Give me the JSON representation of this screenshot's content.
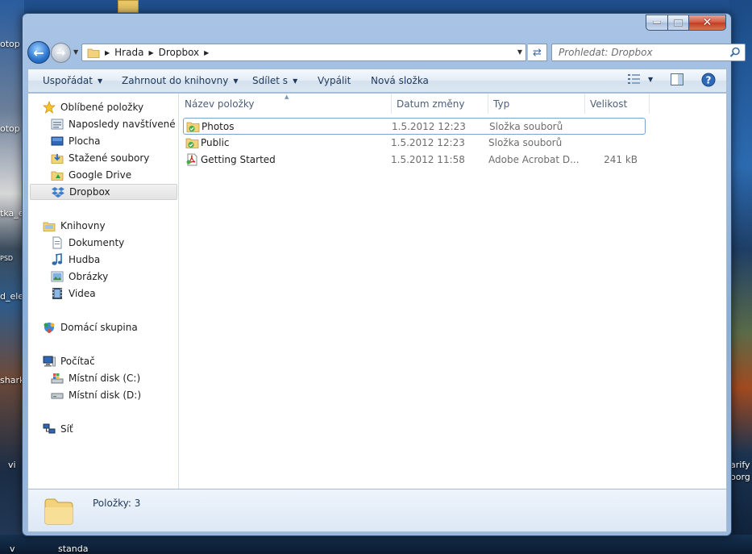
{
  "desktop": {
    "labels": [
      "otop",
      "otop",
      "tka_e",
      "PSD",
      "d_ele",
      "shark",
      "vi",
      "v",
      "standa",
      "arify",
      "oorg"
    ]
  },
  "window": {
    "caption": {
      "close_glyph": "✕"
    }
  },
  "address_bar": {
    "crumbs": [
      "Hrada",
      "Dropbox"
    ]
  },
  "search": {
    "placeholder": "Prohledat: Dropbox"
  },
  "toolbar": {
    "organize": "Uspořádat",
    "include_library": "Zahrnout do knihovny",
    "share": "Sdílet s",
    "burn": "Vypálit",
    "new_folder": "Nová složka"
  },
  "nav_pane": {
    "favorites": {
      "label": "Oblíbené položky",
      "items": [
        "Naposledy navštívené",
        "Plocha",
        "Stažené soubory",
        "Google Drive",
        "Dropbox"
      ]
    },
    "libraries": {
      "label": "Knihovny",
      "items": [
        "Dokumenty",
        "Hudba",
        "Obrázky",
        "Videa"
      ]
    },
    "homegroup": {
      "label": "Domácí skupina"
    },
    "computer": {
      "label": "Počítač",
      "items": [
        "Místní disk (C:)",
        "Místní disk (D:)"
      ]
    },
    "network": {
      "label": "Síť"
    },
    "selected": "Dropbox"
  },
  "file_list": {
    "columns": [
      "Název položky",
      "Datum změny",
      "Typ",
      "Velikost"
    ],
    "rows": [
      {
        "name": "Photos",
        "date": "1.5.2012 12:23",
        "type": "Složka souborů",
        "size": "",
        "icon": "shared-folder-icon"
      },
      {
        "name": "Public",
        "date": "1.5.2012 12:23",
        "type": "Složka souborů",
        "size": "",
        "icon": "shared-folder-icon"
      },
      {
        "name": "Getting Started",
        "date": "1.5.2012 11:58",
        "type": "Adobe Acrobat D...",
        "size": "241 kB",
        "icon": "pdf-icon"
      }
    ]
  },
  "details": {
    "count_text": "Položky: 3"
  },
  "colors": {
    "accent": "#1e395b",
    "selection_border": "#7da2ce",
    "dropbox_blue": "#3b7fd0",
    "folder_yellow": "#f2d27a"
  }
}
